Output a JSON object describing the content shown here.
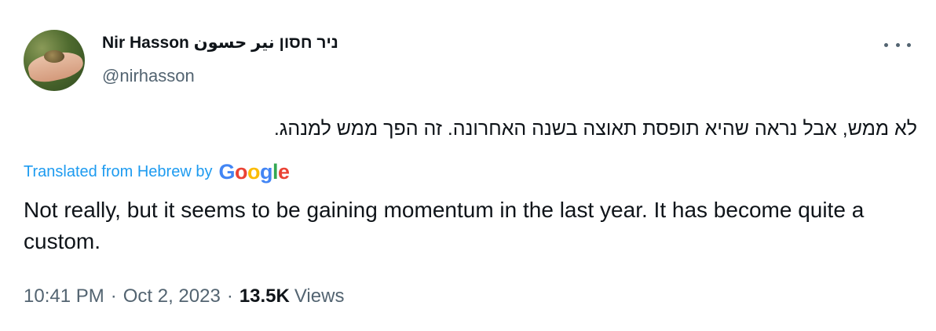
{
  "author": {
    "display_name": "Nir Hasson ניר חסון نير حسون",
    "handle": "@nirhasson"
  },
  "tweet": {
    "original_text": "לא ממש, אבל נראה שהיא תופסת תאוצה בשנה האחרונה. זה הפך ממש למנהג.",
    "translated_from": "Translated from Hebrew by",
    "translator_brand": [
      "G",
      "o",
      "o",
      "g",
      "l",
      "e"
    ],
    "translation_text": "Not really, but it seems to be gaining momentum in the last year. It has become quite a custom.",
    "time": "10:41 PM",
    "date": "Oct 2, 2023",
    "views_count": "13.5K",
    "views_label": "Views",
    "separator": "·"
  },
  "icons": {
    "more": "more-horizontal-icon"
  }
}
